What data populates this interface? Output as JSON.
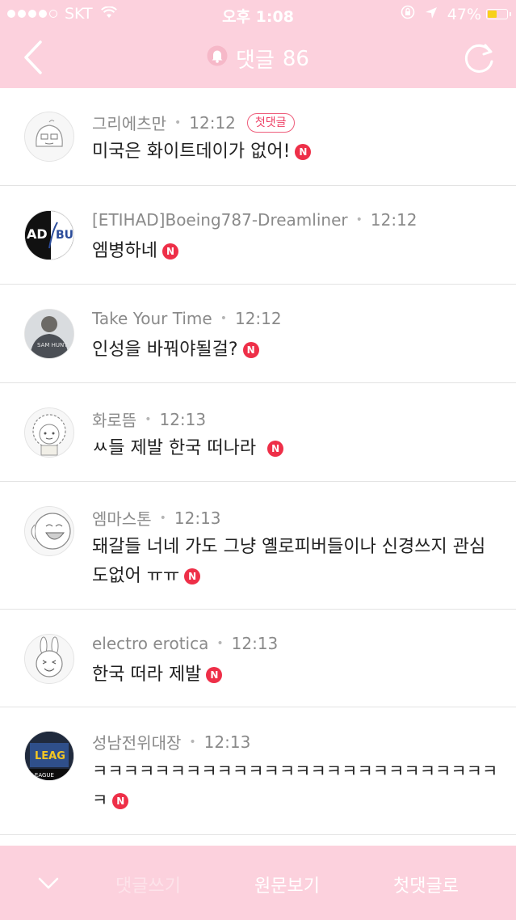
{
  "status_bar": {
    "carrier": "SKT",
    "time": "오후 1:08",
    "battery_percent": "47%",
    "battery_level": 0.47,
    "icons": [
      "signal-dots",
      "wifi-icon",
      "orientation-lock-icon",
      "location-arrow-icon",
      "battery-icon"
    ]
  },
  "nav": {
    "title": "댓글",
    "count": "86",
    "icons": [
      "back-chevron-icon",
      "bell-icon",
      "refresh-icon"
    ]
  },
  "comments": [
    {
      "author": "그리에츠만",
      "time": "12:12",
      "badge": "첫댓글",
      "text": "미국은 화이트데이가 없어!",
      "new": "N",
      "avatar": "sketch-face-avatar"
    },
    {
      "author": "[ETIHAD]Boeing787-Dreamliner",
      "time": "12:12",
      "text": "엠병하네",
      "new": "N",
      "avatar": "airline-logo-avatar"
    },
    {
      "author": "Take Your Time",
      "time": "12:12",
      "text": "인성을 바꿔야될걸?",
      "new": "N",
      "avatar": "photo-shirt-avatar"
    },
    {
      "author": "화로뜸",
      "time": "12:13",
      "text": "ㅆ들 제발 한국 떠나라",
      "new": "N",
      "avatar": "curly-hair-avatar"
    },
    {
      "author": "엠마스톤",
      "time": "12:13",
      "text_line1": "돼갈들 너네 가도 그냥 옐로피버들이나 신경쓰지 관심",
      "text_line2": "도없어 ㅠㅠ",
      "new": "N",
      "avatar": "laughing-face-avatar"
    },
    {
      "author": "electro erotica",
      "time": "12:13",
      "text": "한국 떠라 제발",
      "new": "N",
      "avatar": "rabbit-avatar"
    },
    {
      "author": "성남전위대장",
      "time": "12:13",
      "text_line1": "ㅋㅋㅋㅋㅋㅋㅋㅋㅋㅋㅋㅋㅋㅋㅋㅋㅋㅋㅋㅋㅋㅋㅋㅋㅋㅋ",
      "text_line2": "ㅋ",
      "new": "N",
      "avatar": "league-photo-avatar"
    }
  ],
  "bottom_bar": {
    "write_label": "댓글쓰기",
    "original_label": "원문보기",
    "first_label": "첫댓글로"
  },
  "colors": {
    "header_pink": "#fcd1dd",
    "badge_red": "#ee2f48",
    "text_dark": "#222222",
    "meta_gray": "#8a8a8a"
  }
}
